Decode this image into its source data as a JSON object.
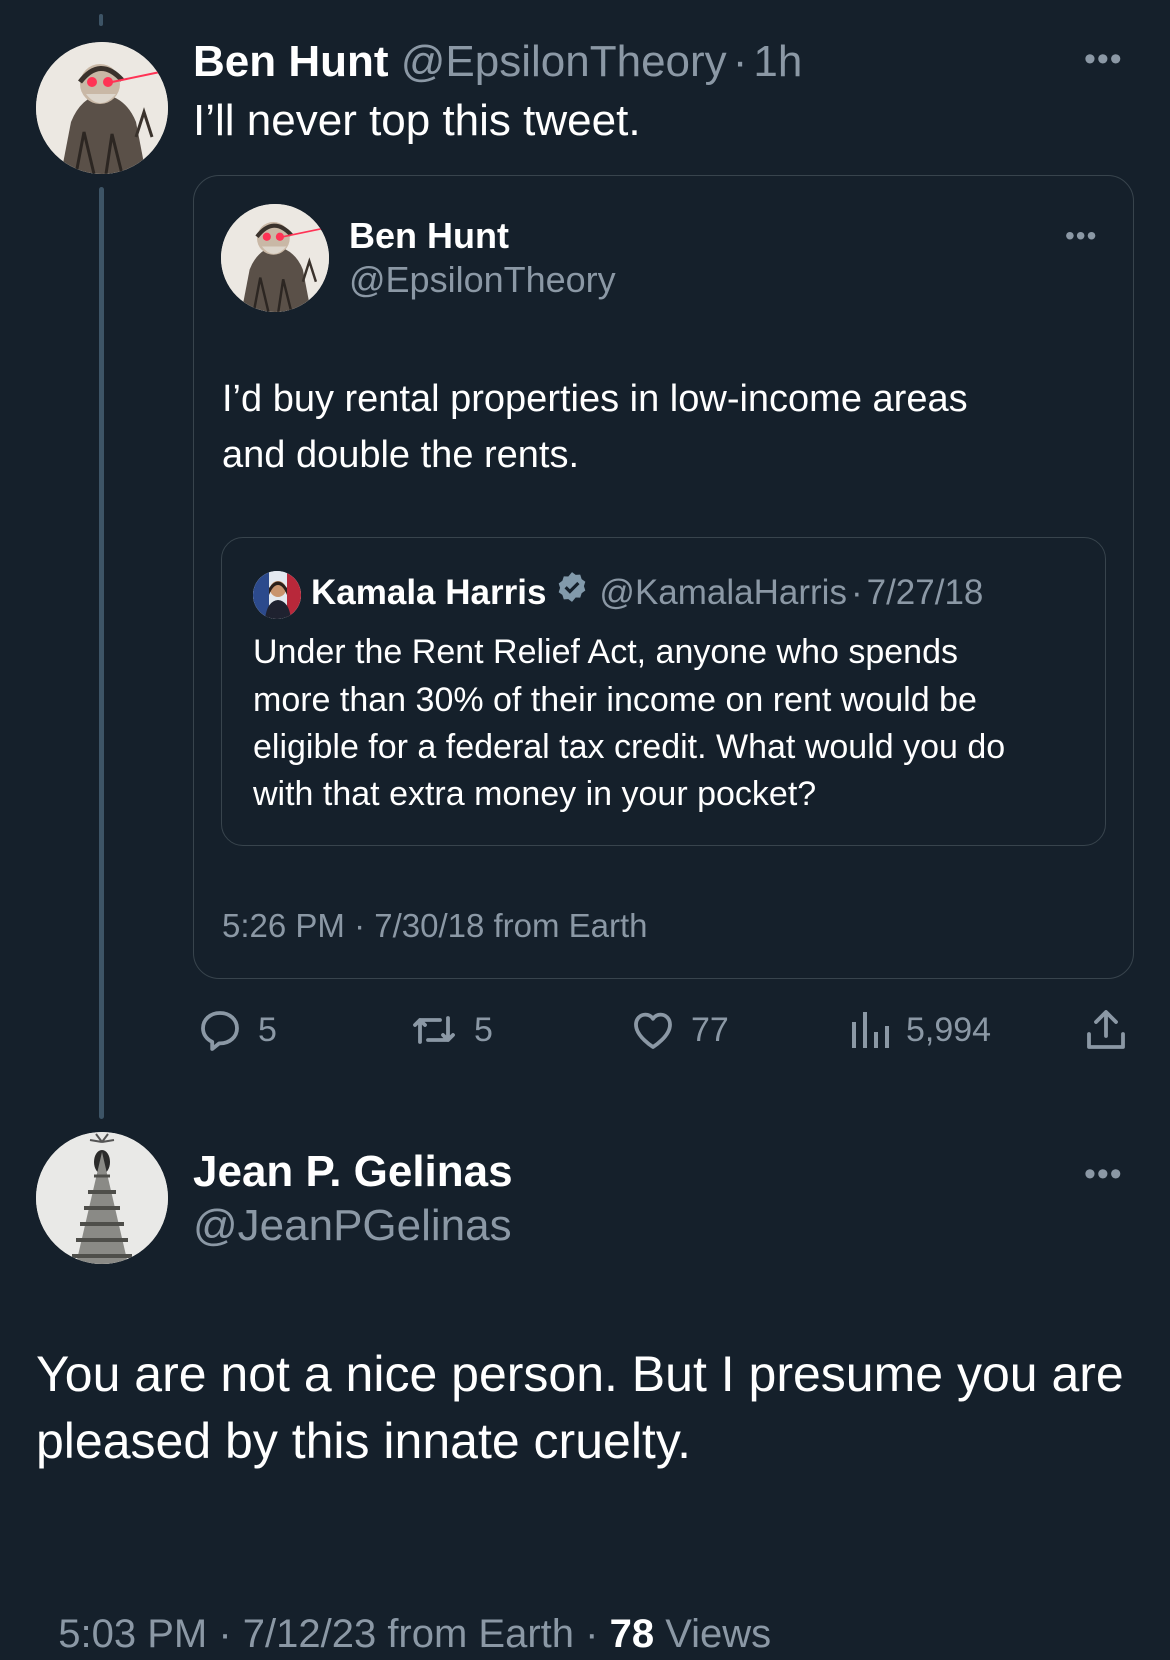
{
  "main_tweet": {
    "author_name": "Ben Hunt",
    "author_handle": "@EpsilonTheory",
    "separator": "·",
    "time_ago": "1h",
    "text": "I’ll never top this tweet."
  },
  "quoted_tweet": {
    "author_name": "Ben Hunt",
    "author_handle": "@EpsilonTheory",
    "text_line1": "I’d buy rental properties in low-income areas",
    "text_line2": "and double the rents.",
    "timestamp": "5:26 PM · 7/30/18 from Earth"
  },
  "nested_quote": {
    "author_name": "Kamala Harris",
    "author_handle": "@KamalaHarris",
    "separator": "·",
    "date": "7/27/18",
    "text_line1": "Under the Rent Relief Act, anyone who spends",
    "text_line2": "more than 30% of their income on rent would be",
    "text_line3": "eligible for a federal tax credit. What would you do",
    "text_line4": "with that extra money in your pocket?"
  },
  "actions": {
    "replies": "5",
    "retweets": "5",
    "likes": "77",
    "views": "5,994"
  },
  "reply_tweet": {
    "author_name": "Jean P. Gelinas",
    "author_handle": "@JeanPGelinas",
    "text_line1": "You are not a nice person. But I presume you are",
    "text_line2": "pleased by this innate cruelty.",
    "timestamp": "5:03 PM · 7/12/23 from Earth · ",
    "views_count": "78",
    "views_label": " Views"
  },
  "icons": {
    "reply": "speech-bubble-icon",
    "retweet": "retweet-arrows-icon",
    "like": "heart-icon",
    "views": "bar-chart-icon",
    "share": "upload-icon",
    "more": "more-options-icon",
    "verified": "verified-badge-icon"
  },
  "colors": {
    "background": "#15202b",
    "text": "#ffffff",
    "secondary": "#8b98a5",
    "border": "#38444d",
    "thread_line": "#3d5466",
    "verified": "#829aab"
  }
}
